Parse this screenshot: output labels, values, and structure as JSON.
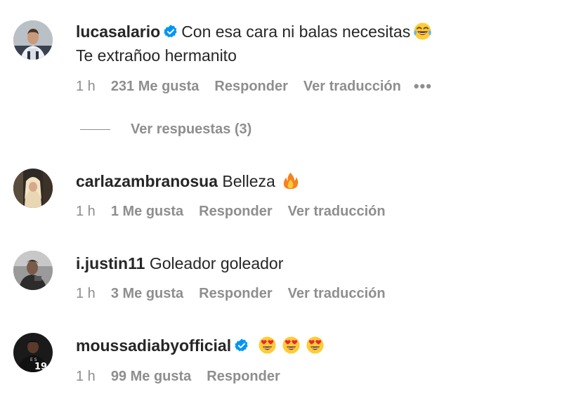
{
  "comments": [
    {
      "username": "lucasalario",
      "verified": true,
      "text": "Con esa cara ni balas necesitas",
      "text_emoji": "face-with-tears-of-joy",
      "line2": "Te extrañoo hermanito",
      "time": "1 h",
      "likes": "231 Me gusta",
      "reply": "Responder",
      "translate": "Ver traducción",
      "more": "•••",
      "view_replies": "Ver respuestas (3)"
    },
    {
      "username": "carlazambranosua",
      "verified": false,
      "text": "Belleza",
      "text_emoji": "fire",
      "time": "1 h",
      "likes": "1 Me gusta",
      "reply": "Responder",
      "translate": "Ver traducción"
    },
    {
      "username": "i.justin11",
      "verified": false,
      "text": "Goleador goleador",
      "time": "1 h",
      "likes": "3 Me gusta",
      "reply": "Responder",
      "translate": "Ver traducción"
    },
    {
      "username": "moussadiabyofficial",
      "verified": true,
      "text_emoji": "smiling-face-with-heart-eyes x3",
      "time": "1 h",
      "likes": "99 Me gusta",
      "reply": "Responder"
    }
  ],
  "colors": {
    "text": "#262626",
    "muted": "#8e8e8e",
    "verified": "#0095f6"
  }
}
